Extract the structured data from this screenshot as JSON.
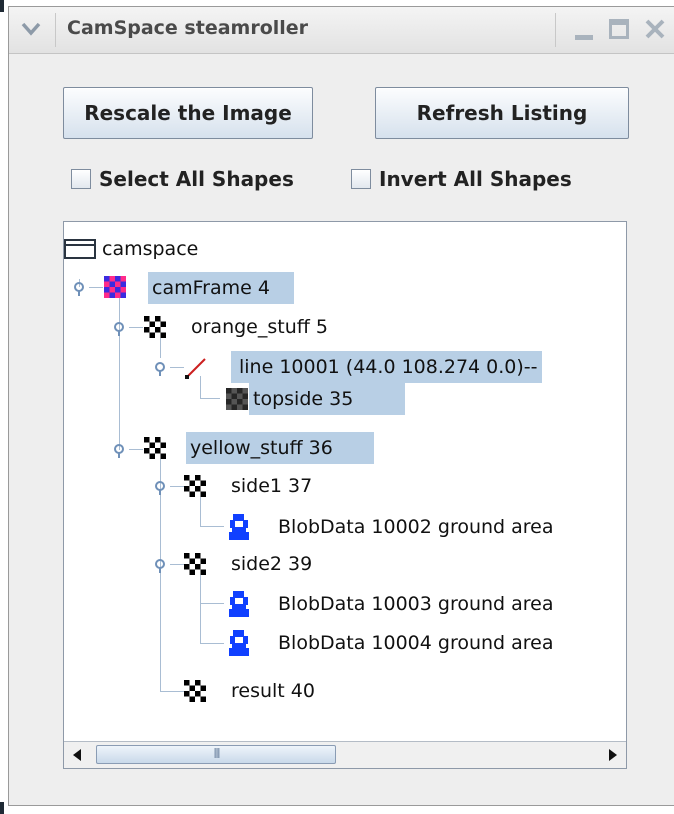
{
  "window": {
    "title": "CamSpace steamroller",
    "menu_icon": "chevron-down-icon",
    "minimize_icon": "minimize-icon",
    "maximize_icon": "maximize-icon",
    "close_icon": "close-icon"
  },
  "toolbar": {
    "rescale_label": "Rescale the Image",
    "refresh_label": "Refresh Listing"
  },
  "options": {
    "select_all_label": "Select All Shapes",
    "select_all_checked": false,
    "invert_all_label": "Invert All Shapes",
    "invert_all_checked": false
  },
  "tree": {
    "nodes": [
      {
        "label": "camspace",
        "icon": "folder-icon",
        "selected": false
      },
      {
        "label": "camFrame 4",
        "icon": "checker-red-blue-icon",
        "selected": true
      },
      {
        "label": "orange_stuff 5",
        "icon": "checker-shape-icon",
        "selected": false
      },
      {
        "label": "line 10001 (44.0 108.274 0.0)--",
        "icon": "line-shape-icon",
        "selected": true
      },
      {
        "label": "topside 35",
        "icon": "checker-gray-icon",
        "selected": true
      },
      {
        "label": "yellow_stuff 36",
        "icon": "checker-shape-icon",
        "selected": true
      },
      {
        "label": "side1 37",
        "icon": "checker-shape-icon",
        "selected": false
      },
      {
        "label": "BlobData 10002 ground area",
        "icon": "blob-icon",
        "selected": false
      },
      {
        "label": "side2 39",
        "icon": "checker-shape-icon",
        "selected": false
      },
      {
        "label": "BlobData 10003 ground area",
        "icon": "blob-icon",
        "selected": false
      },
      {
        "label": "BlobData 10004 ground area",
        "icon": "blob-icon",
        "selected": false
      },
      {
        "label": "result 40",
        "icon": "checker-shape-icon",
        "selected": false
      }
    ]
  },
  "scrollbar": {
    "left_icon": "scroll-left-icon",
    "right_icon": "scroll-right-icon",
    "thumb_grip": "III"
  },
  "colors": {
    "selection": "#b8cfe5",
    "tree_lines": "#a9bdd3",
    "blob": "#1040ff",
    "line_shape": "#cc2020"
  }
}
